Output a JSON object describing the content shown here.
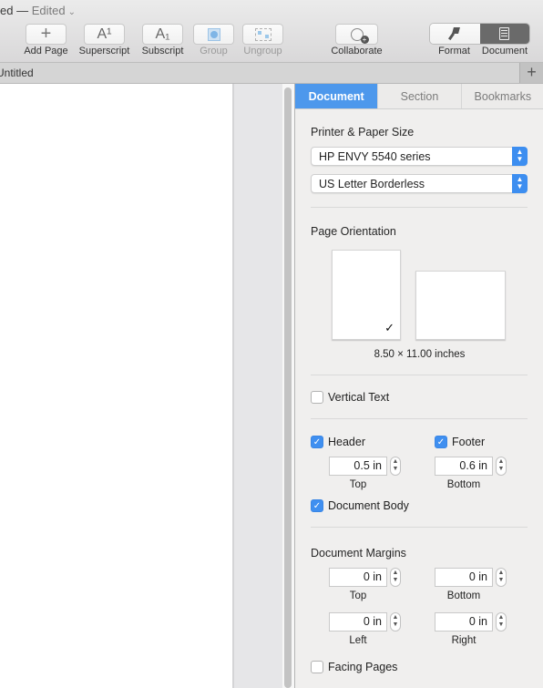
{
  "window": {
    "title_fragment": "ed",
    "separator": " — ",
    "status": "Edited",
    "chevron": "⌄"
  },
  "toolbar": {
    "buttons": [
      {
        "label": "Add Page",
        "icon": "+",
        "icon_name": "plus-icon",
        "enabled": true
      },
      {
        "label": "Superscript",
        "icon": "A¹",
        "icon_name": "superscript-icon",
        "enabled": true
      },
      {
        "label": "Subscript",
        "icon": "A₁",
        "icon_name": "subscript-icon",
        "enabled": true
      },
      {
        "label": "Group",
        "icon": "◙",
        "icon_name": "group-icon",
        "enabled": false
      },
      {
        "label": "Ungroup",
        "icon": "⊞",
        "icon_name": "ungroup-icon",
        "enabled": false
      },
      {
        "label": "Collaborate",
        "icon": "👤",
        "icon_name": "collaborate-icon",
        "enabled": true
      }
    ],
    "segmented": {
      "format_label": "Format",
      "document_label": "Document",
      "selected": "Document"
    }
  },
  "tabbar": {
    "tab_title": "Untitled",
    "add_tab_icon": "+"
  },
  "inspector": {
    "tabs": [
      {
        "label": "Document",
        "active": true
      },
      {
        "label": "Section",
        "active": false
      },
      {
        "label": "Bookmarks",
        "active": false
      }
    ],
    "printer_paper": {
      "heading": "Printer & Paper Size",
      "printer": "HP ENVY 5540 series",
      "paper": "US Letter Borderless"
    },
    "orientation": {
      "heading": "Page Orientation",
      "selected": "portrait",
      "check": "✓",
      "dimensions": "8.50 × 11.00 inches"
    },
    "vertical_text": {
      "label": "Vertical Text",
      "checked": false
    },
    "header": {
      "label": "Header",
      "checked": true,
      "value": "0.5 in",
      "caption": "Top"
    },
    "footer": {
      "label": "Footer",
      "checked": true,
      "value": "0.6 in",
      "caption": "Bottom"
    },
    "document_body": {
      "label": "Document Body",
      "checked": true
    },
    "margins": {
      "heading": "Document Margins",
      "top": {
        "value": "0 in",
        "caption": "Top"
      },
      "bottom": {
        "value": "0 in",
        "caption": "Bottom"
      },
      "left": {
        "value": "0 in",
        "caption": "Left"
      },
      "right": {
        "value": "0 in",
        "caption": "Right"
      }
    },
    "facing_pages": {
      "label": "Facing Pages",
      "checked": false
    },
    "check_glyph": "✓",
    "stepper_glyph": "⌃⌄",
    "popup_glyph": "⌃⌄"
  }
}
